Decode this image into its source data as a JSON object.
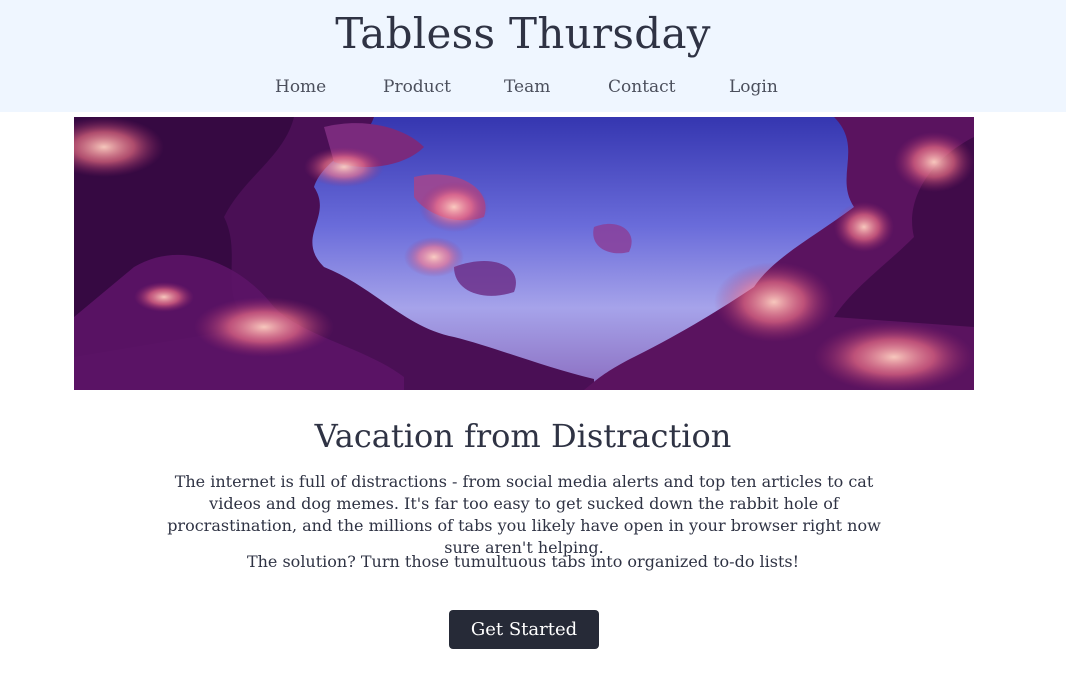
{
  "brand": {
    "title": "Tabless Thursday"
  },
  "nav": {
    "items": [
      {
        "label": "Home"
      },
      {
        "label": "Product"
      },
      {
        "label": "Team"
      },
      {
        "label": "Contact"
      },
      {
        "label": "Login"
      }
    ]
  },
  "hero": {
    "image": "purple-sunset-clouds-banner"
  },
  "main": {
    "heading": "Vacation from Distraction",
    "paragraph_1": "The internet is full of distractions - from social media alerts and top ten articles to cat videos and dog memes. It's far too easy to get sucked down the rabbit hole of procrastination, and the millions of tabs you likely have open in your browser right now sure aren't helping.",
    "paragraph_2": "The solution? Turn those tumultuous tabs into organized to-do lists!",
    "cta_label": "Get Started"
  },
  "colors": {
    "header_bg": "#eff6ff",
    "text": "#2f3344",
    "button_bg": "#262a37",
    "button_text": "#ffffff"
  }
}
